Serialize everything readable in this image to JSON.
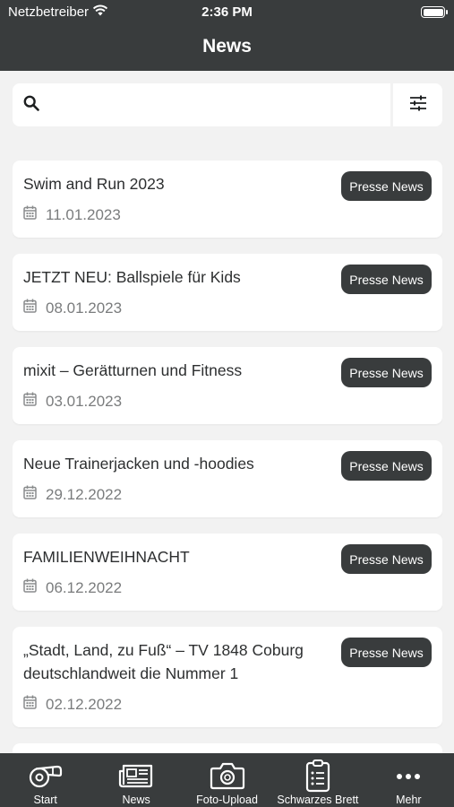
{
  "status_bar": {
    "carrier": "Netzbetreiber",
    "time": "2:36 PM"
  },
  "header": {
    "title": "News"
  },
  "search": {
    "placeholder": ""
  },
  "news": [
    {
      "title": "Swim and Run 2023",
      "date": "11.01.2023",
      "badge": "Presse News"
    },
    {
      "title": "JETZT NEU: Ballspiele für Kids",
      "date": "08.01.2023",
      "badge": "Presse News"
    },
    {
      "title": "mixit – Gerätturnen und Fitness",
      "date": "03.01.2023",
      "badge": "Presse News"
    },
    {
      "title": "Neue Trainerjacken und -hoodies",
      "date": "29.12.2022",
      "badge": "Presse News"
    },
    {
      "title": "FAMILIENWEIHNACHT",
      "date": "06.12.2022",
      "badge": "Presse News"
    },
    {
      "title": "„Stadt, Land, zu Fuß“ – TV 1848 Coburg deutschlandweit die Nummer 1",
      "date": "02.12.2022",
      "badge": "Presse News"
    },
    {
      "title": "",
      "date": "",
      "badge": ""
    }
  ],
  "tabbar": [
    {
      "label": "Start",
      "icon": "whistle-icon"
    },
    {
      "label": "News",
      "icon": "newspaper-icon"
    },
    {
      "label": "Foto-Upload",
      "icon": "camera-icon"
    },
    {
      "label": "Schwarzes Brett",
      "icon": "clipboard-icon"
    },
    {
      "label": "Mehr",
      "icon": "more-icon"
    }
  ]
}
